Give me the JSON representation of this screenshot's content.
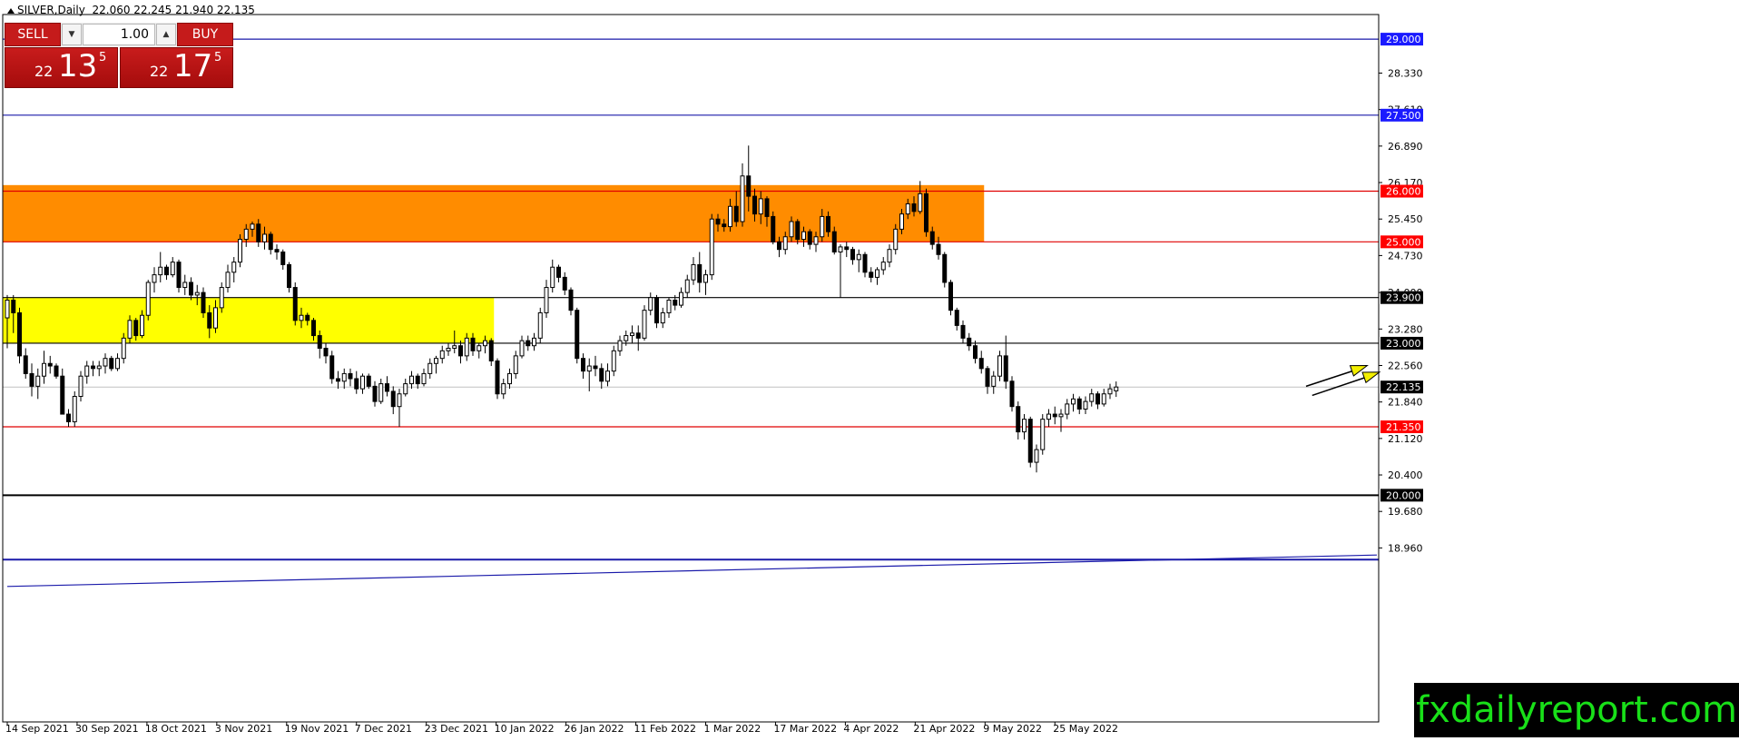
{
  "header": {
    "symbol": "SILVER,Daily",
    "ohlc": "22.060 22.245 21.940 22.135"
  },
  "trade_panel": {
    "sell_label": "SELL",
    "buy_label": "BUY",
    "lot_value": "1.00",
    "sell_price": {
      "prefix": "22",
      "big": "13",
      "sup": "5"
    },
    "buy_price": {
      "prefix": "22",
      "big": "17",
      "sup": "5"
    }
  },
  "watermark": "fxdailyreport.com",
  "colors": {
    "bull": "#ffffff",
    "bear": "#000000",
    "resistance_zone": "#ff8c00",
    "support_zone": "#ffff00",
    "red_line": "#e00000",
    "blue_line": "#1a1aaa",
    "label_blue_bg": "#1a1aff",
    "label_red_bg": "#ff0000",
    "label_black_bg": "#000000",
    "arrow": "#f2ee00"
  },
  "chart_data": {
    "type": "candlestick",
    "title": "SILVER,Daily",
    "ylim": [
      18.25,
      29.45
    ],
    "y_ticks": [
      "28.330",
      "27.610",
      "26.890",
      "26.170",
      "25.450",
      "24.730",
      "24.000",
      "23.280",
      "22.560",
      "21.840",
      "21.120",
      "20.400",
      "19.680",
      "18.960"
    ],
    "x_ticks": [
      "14 Sep 2021",
      "30 Sep 2021",
      "18 Oct 2021",
      "3 Nov 2021",
      "19 Nov 2021",
      "7 Dec 2021",
      "23 Dec 2021",
      "10 Jan 2022",
      "26 Jan 2022",
      "11 Feb 2022",
      "1 Mar 2022",
      "17 Mar 2022",
      "4 Apr 2022",
      "21 Apr 2022",
      "9 May 2022",
      "25 May 2022"
    ],
    "current_price": "22.135",
    "levels": [
      {
        "value": 29.0,
        "label": "29.000",
        "style": "blue"
      },
      {
        "value": 27.5,
        "label": "27.500",
        "style": "blue"
      },
      {
        "value": 26.0,
        "label": "26.000",
        "style": "red"
      },
      {
        "value": 25.0,
        "label": "25.000",
        "style": "red"
      },
      {
        "value": 23.9,
        "label": "23.900",
        "style": "black"
      },
      {
        "value": 23.0,
        "label": "23.000",
        "style": "black"
      },
      {
        "value": 21.35,
        "label": "21.350",
        "style": "red"
      },
      {
        "value": 20.0,
        "label": "20.000",
        "style": "black"
      }
    ],
    "zones": [
      {
        "from": 25.0,
        "to": 26.12,
        "color": "orange",
        "start_index": 0,
        "end_index": 159
      },
      {
        "from": 23.0,
        "to": 23.9,
        "color": "yellow",
        "start_index": 0,
        "end_index": 79
      }
    ],
    "trendline": {
      "from_index": 0,
      "from_value": 18.2,
      "to_index": 209,
      "to_value": 18.82
    },
    "candles": [
      [
        23.5,
        23.95,
        22.9,
        23.85
      ],
      [
        23.85,
        23.95,
        23.2,
        23.6
      ],
      [
        23.6,
        23.7,
        22.6,
        22.75
      ],
      [
        22.75,
        22.9,
        22.3,
        22.4
      ],
      [
        22.4,
        22.6,
        21.95,
        22.15
      ],
      [
        22.15,
        22.5,
        21.9,
        22.35
      ],
      [
        22.35,
        22.85,
        22.2,
        22.6
      ],
      [
        22.6,
        22.75,
        22.4,
        22.55
      ],
      [
        22.55,
        22.6,
        22.3,
        22.35
      ],
      [
        22.35,
        22.5,
        21.6,
        21.6
      ],
      [
        21.6,
        21.7,
        21.35,
        21.45
      ],
      [
        21.45,
        22.05,
        21.35,
        21.95
      ],
      [
        21.95,
        22.45,
        21.85,
        22.35
      ],
      [
        22.35,
        22.65,
        22.2,
        22.55
      ],
      [
        22.55,
        22.65,
        22.35,
        22.5
      ],
      [
        22.5,
        22.65,
        22.35,
        22.55
      ],
      [
        22.55,
        22.8,
        22.4,
        22.7
      ],
      [
        22.7,
        22.75,
        22.45,
        22.5
      ],
      [
        22.5,
        22.8,
        22.45,
        22.7
      ],
      [
        22.7,
        23.2,
        22.6,
        23.1
      ],
      [
        23.1,
        23.55,
        23.0,
        23.45
      ],
      [
        23.45,
        23.5,
        23.05,
        23.15
      ],
      [
        23.15,
        23.65,
        23.1,
        23.55
      ],
      [
        23.55,
        24.25,
        23.45,
        24.2
      ],
      [
        24.2,
        24.5,
        24.0,
        24.35
      ],
      [
        24.35,
        24.8,
        24.2,
        24.5
      ],
      [
        24.5,
        24.55,
        24.25,
        24.35
      ],
      [
        24.35,
        24.7,
        24.3,
        24.6
      ],
      [
        24.6,
        24.65,
        24.0,
        24.1
      ],
      [
        24.1,
        24.35,
        23.95,
        24.2
      ],
      [
        24.2,
        24.3,
        23.85,
        23.95
      ],
      [
        23.95,
        24.15,
        23.75,
        24.0
      ],
      [
        24.0,
        24.1,
        23.5,
        23.6
      ],
      [
        23.6,
        23.75,
        23.1,
        23.3
      ],
      [
        23.3,
        23.85,
        23.2,
        23.7
      ],
      [
        23.7,
        24.2,
        23.6,
        24.1
      ],
      [
        24.1,
        24.55,
        24.0,
        24.4
      ],
      [
        24.4,
        24.7,
        24.2,
        24.6
      ],
      [
        24.6,
        25.15,
        24.5,
        25.05
      ],
      [
        25.05,
        25.35,
        24.9,
        25.25
      ],
      [
        25.25,
        25.4,
        25.1,
        25.35
      ],
      [
        25.35,
        25.45,
        24.9,
        25.0
      ],
      [
        25.0,
        25.3,
        24.85,
        25.15
      ],
      [
        25.15,
        25.2,
        24.75,
        24.85
      ],
      [
        24.85,
        24.95,
        24.65,
        24.8
      ],
      [
        24.8,
        24.85,
        24.45,
        24.55
      ],
      [
        24.55,
        24.6,
        24.0,
        24.1
      ],
      [
        24.1,
        24.2,
        23.35,
        23.45
      ],
      [
        23.45,
        23.7,
        23.3,
        23.55
      ],
      [
        23.55,
        23.6,
        23.35,
        23.45
      ],
      [
        23.45,
        23.5,
        23.05,
        23.15
      ],
      [
        23.15,
        23.25,
        22.7,
        22.9
      ],
      [
        22.9,
        23.0,
        22.6,
        22.75
      ],
      [
        22.75,
        22.85,
        22.2,
        22.3
      ],
      [
        22.3,
        22.45,
        22.1,
        22.25
      ],
      [
        22.25,
        22.5,
        22.1,
        22.4
      ],
      [
        22.4,
        22.5,
        22.15,
        22.3
      ],
      [
        22.3,
        22.45,
        22.0,
        22.1
      ],
      [
        22.1,
        22.4,
        22.0,
        22.35
      ],
      [
        22.35,
        22.4,
        22.1,
        22.15
      ],
      [
        22.15,
        22.25,
        21.75,
        21.85
      ],
      [
        21.85,
        22.3,
        21.8,
        22.2
      ],
      [
        22.2,
        22.35,
        21.95,
        22.05
      ],
      [
        22.05,
        22.15,
        21.6,
        21.75
      ],
      [
        21.75,
        22.1,
        21.35,
        22.0
      ],
      [
        22.0,
        22.3,
        21.95,
        22.2
      ],
      [
        22.2,
        22.45,
        22.1,
        22.35
      ],
      [
        22.35,
        22.4,
        22.1,
        22.2
      ],
      [
        22.2,
        22.5,
        22.15,
        22.4
      ],
      [
        22.4,
        22.7,
        22.3,
        22.6
      ],
      [
        22.6,
        22.75,
        22.4,
        22.7
      ],
      [
        22.7,
        22.95,
        22.6,
        22.85
      ],
      [
        22.85,
        23.0,
        22.75,
        22.9
      ],
      [
        22.9,
        23.25,
        22.8,
        22.95
      ],
      [
        22.95,
        23.05,
        22.6,
        22.75
      ],
      [
        22.75,
        23.2,
        22.65,
        23.1
      ],
      [
        23.1,
        23.2,
        22.75,
        22.85
      ],
      [
        22.85,
        23.0,
        22.7,
        22.95
      ],
      [
        22.95,
        23.15,
        22.8,
        23.05
      ],
      [
        23.05,
        23.1,
        22.55,
        22.65
      ],
      [
        22.65,
        22.7,
        21.9,
        22.0
      ],
      [
        22.0,
        22.3,
        21.9,
        22.2
      ],
      [
        22.2,
        22.5,
        22.1,
        22.4
      ],
      [
        22.4,
        22.85,
        22.3,
        22.75
      ],
      [
        22.75,
        23.15,
        22.7,
        23.05
      ],
      [
        23.05,
        23.15,
        22.85,
        22.95
      ],
      [
        22.95,
        23.2,
        22.85,
        23.1
      ],
      [
        23.1,
        23.7,
        23.0,
        23.6
      ],
      [
        23.6,
        24.25,
        23.5,
        24.1
      ],
      [
        24.1,
        24.65,
        24.0,
        24.5
      ],
      [
        24.5,
        24.55,
        24.2,
        24.3
      ],
      [
        24.3,
        24.4,
        23.95,
        24.05
      ],
      [
        24.05,
        24.1,
        23.55,
        23.65
      ],
      [
        23.65,
        23.7,
        22.6,
        22.7
      ],
      [
        22.7,
        22.8,
        22.3,
        22.45
      ],
      [
        22.45,
        22.7,
        22.05,
        22.55
      ],
      [
        22.55,
        22.75,
        22.35,
        22.5
      ],
      [
        22.5,
        22.6,
        22.1,
        22.25
      ],
      [
        22.25,
        22.6,
        22.15,
        22.45
      ],
      [
        22.45,
        22.95,
        22.35,
        22.85
      ],
      [
        22.85,
        23.15,
        22.75,
        23.05
      ],
      [
        23.05,
        23.25,
        22.95,
        23.15
      ],
      [
        23.15,
        23.35,
        23.0,
        23.2
      ],
      [
        23.2,
        23.35,
        22.85,
        23.1
      ],
      [
        23.1,
        23.75,
        23.05,
        23.65
      ],
      [
        23.65,
        24.0,
        23.55,
        23.9
      ],
      [
        23.9,
        23.95,
        23.3,
        23.4
      ],
      [
        23.4,
        23.7,
        23.3,
        23.6
      ],
      [
        23.6,
        23.9,
        23.5,
        23.85
      ],
      [
        23.85,
        23.95,
        23.65,
        23.75
      ],
      [
        23.75,
        24.1,
        23.7,
        24.0
      ],
      [
        24.0,
        24.35,
        23.9,
        24.25
      ],
      [
        24.25,
        24.7,
        24.15,
        24.55
      ],
      [
        24.55,
        24.8,
        24.0,
        24.2
      ],
      [
        24.2,
        24.45,
        23.95,
        24.35
      ],
      [
        24.35,
        25.55,
        24.25,
        25.45
      ],
      [
        25.45,
        25.55,
        25.2,
        25.35
      ],
      [
        25.35,
        25.45,
        25.2,
        25.3
      ],
      [
        25.3,
        25.85,
        25.2,
        25.7
      ],
      [
        25.7,
        26.0,
        25.3,
        25.4
      ],
      [
        25.4,
        26.55,
        25.3,
        26.3
      ],
      [
        26.3,
        26.9,
        25.6,
        25.9
      ],
      [
        25.9,
        26.05,
        25.4,
        25.55
      ],
      [
        25.55,
        26.0,
        25.35,
        25.85
      ],
      [
        25.85,
        25.9,
        25.3,
        25.5
      ],
      [
        25.5,
        25.6,
        24.95,
        25.0
      ],
      [
        25.0,
        25.1,
        24.7,
        24.85
      ],
      [
        24.85,
        25.2,
        24.75,
        25.1
      ],
      [
        25.1,
        25.5,
        25.0,
        25.4
      ],
      [
        25.4,
        25.45,
        24.95,
        25.05
      ],
      [
        25.05,
        25.3,
        24.9,
        25.2
      ],
      [
        25.2,
        25.25,
        24.85,
        24.95
      ],
      [
        24.95,
        25.2,
        24.8,
        25.1
      ],
      [
        25.1,
        25.65,
        25.0,
        25.5
      ],
      [
        25.5,
        25.6,
        25.1,
        25.2
      ],
      [
        25.2,
        25.3,
        24.75,
        24.8
      ],
      [
        24.8,
        24.95,
        23.9,
        24.9
      ],
      [
        24.9,
        25.0,
        24.7,
        24.85
      ],
      [
        24.85,
        24.9,
        24.55,
        24.65
      ],
      [
        24.65,
        24.85,
        24.4,
        24.75
      ],
      [
        24.75,
        24.8,
        24.3,
        24.4
      ],
      [
        24.4,
        24.5,
        24.2,
        24.3
      ],
      [
        24.3,
        24.5,
        24.15,
        24.45
      ],
      [
        24.45,
        24.7,
        24.35,
        24.6
      ],
      [
        24.6,
        24.95,
        24.5,
        24.85
      ],
      [
        24.85,
        25.35,
        24.75,
        25.25
      ],
      [
        25.25,
        25.65,
        25.15,
        25.55
      ],
      [
        25.55,
        25.85,
        25.45,
        25.75
      ],
      [
        25.75,
        25.9,
        25.5,
        25.6
      ],
      [
        25.6,
        26.2,
        25.55,
        25.95
      ],
      [
        25.95,
        26.05,
        25.1,
        25.2
      ],
      [
        25.2,
        25.3,
        24.85,
        24.95
      ],
      [
        24.95,
        25.1,
        24.65,
        24.75
      ],
      [
        24.75,
        24.8,
        24.1,
        24.2
      ],
      [
        24.2,
        24.25,
        23.55,
        23.65
      ],
      [
        23.65,
        23.7,
        23.25,
        23.35
      ],
      [
        23.35,
        23.45,
        23.0,
        23.1
      ],
      [
        23.1,
        23.2,
        22.85,
        22.95
      ],
      [
        22.95,
        23.05,
        22.6,
        22.7
      ],
      [
        22.7,
        22.85,
        22.4,
        22.5
      ],
      [
        22.5,
        22.55,
        22.0,
        22.15
      ],
      [
        22.15,
        22.45,
        22.0,
        22.35
      ],
      [
        22.35,
        22.85,
        22.25,
        22.75
      ],
      [
        22.75,
        23.15,
        22.1,
        22.25
      ],
      [
        22.25,
        22.35,
        21.65,
        21.75
      ],
      [
        21.75,
        21.85,
        21.1,
        21.25
      ],
      [
        21.25,
        21.6,
        21.1,
        21.5
      ],
      [
        21.5,
        21.55,
        20.55,
        20.65
      ],
      [
        20.65,
        21.0,
        20.45,
        20.9
      ],
      [
        20.9,
        21.6,
        20.8,
        21.5
      ],
      [
        21.5,
        21.7,
        21.35,
        21.6
      ],
      [
        21.6,
        21.75,
        21.4,
        21.55
      ],
      [
        21.55,
        21.7,
        21.25,
        21.6
      ],
      [
        21.6,
        21.9,
        21.5,
        21.8
      ],
      [
        21.8,
        22.0,
        21.65,
        21.9
      ],
      [
        21.9,
        21.95,
        21.6,
        21.7
      ],
      [
        21.7,
        21.95,
        21.6,
        21.85
      ],
      [
        21.85,
        22.1,
        21.75,
        22.0
      ],
      [
        22.0,
        22.05,
        21.7,
        21.8
      ],
      [
        21.8,
        22.1,
        21.75,
        22.0
      ],
      [
        22.0,
        22.2,
        21.9,
        22.1
      ],
      [
        22.06,
        22.245,
        21.94,
        22.135
      ]
    ],
    "annotations": [
      {
        "type": "arrow",
        "from_index": 212,
        "from_value": 22.15,
        "to_index": 222,
        "to_value": 22.56
      },
      {
        "type": "arrow",
        "from_index": 213,
        "from_value": 21.97,
        "to_index": 224,
        "to_value": 22.43
      }
    ]
  }
}
